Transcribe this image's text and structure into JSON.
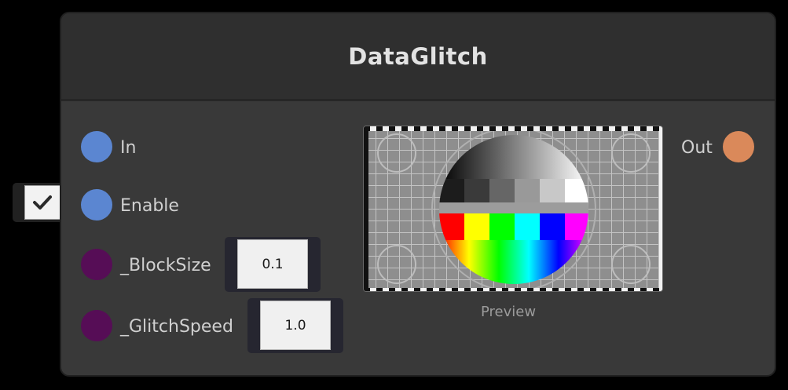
{
  "node": {
    "title": "DataGlitch",
    "inputs": [
      {
        "label": "In",
        "color": "#5b86d1"
      },
      {
        "label": "Enable",
        "color": "#5b86d1"
      },
      {
        "label": "_BlockSize",
        "color": "#560d56"
      },
      {
        "label": "_GlitchSpeed",
        "color": "#560d56"
      }
    ],
    "output": {
      "label": "Out",
      "color": "#da895a"
    },
    "enable_checked": true,
    "block_size_value": "0.1",
    "glitch_speed_value": "1.0",
    "preview_label": "Preview"
  },
  "icons": {
    "checkbox": "checkmark-icon"
  }
}
